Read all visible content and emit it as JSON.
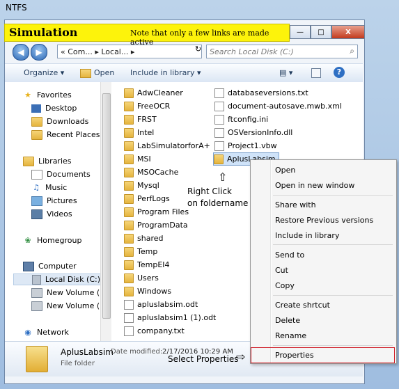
{
  "window": {
    "title": "NTFS"
  },
  "banner": {
    "title": "Simulation",
    "note": "Note that only a few links are made active"
  },
  "window_buttons": {
    "minimize": "—",
    "maximize": "□",
    "close": "X"
  },
  "address": {
    "back": "◀",
    "forward": "▶",
    "path": "«  Com...  ▸  Local...  ▸",
    "refresh": "↻",
    "search_placeholder": "Search Local Disk (C:)"
  },
  "toolbar": {
    "organize": "Organize ▾",
    "open": "Open",
    "include": "Include in library ▾",
    "views": "▤ ▾",
    "help": "?"
  },
  "nav": {
    "favorites": "Favorites",
    "desktop": "Desktop",
    "downloads": "Downloads",
    "recent": "Recent Places",
    "libraries": "Libraries",
    "documents": "Documents",
    "music": "Music",
    "pictures": "Pictures",
    "videos": "Videos",
    "homegroup": "Homegroup",
    "computer": "Computer",
    "localdisk": "Local Disk (C:)",
    "vol_e": "New Volume (E:)",
    "vol_f": "New Volume (F:)",
    "network": "Network"
  },
  "files_left": [
    "AdwCleaner",
    "FreeOCR",
    "FRST",
    "Intel",
    "LabSimulatorforA+",
    "MSI",
    "MSOCache",
    "Mysql",
    "PerfLogs",
    "Program Files",
    "ProgramData",
    "shared",
    "Temp",
    "TempEI4",
    "Users",
    "Windows",
    "apluslabsim.odt",
    "apluslabsim1 (1).odt",
    "company.txt"
  ],
  "files_right": [
    "databaseversions.txt",
    "document-autosave.mwb.xml",
    "ftconfig.ini",
    "OSVersionInfo.dll",
    "Project1.vbw",
    "AplusLabsim"
  ],
  "status": {
    "name": "AplusLabsim",
    "meta": "Date modified:",
    "date": "2/17/2016 10:29 AM",
    "type": "File folder"
  },
  "context_menu": {
    "open": "Open",
    "open_new": "Open in new window",
    "share": "Share with",
    "restore": "Restore Previous versions",
    "include": "Include in library",
    "send": "Send to",
    "cut": "Cut",
    "copy": "Copy",
    "shortcut": "Create shrtcut",
    "delete": "Delete",
    "rename": "Rename",
    "properties": "Properties"
  },
  "annotations": {
    "right_click_1": "Right Click",
    "right_click_2": "on foldername",
    "select_props": "Select Properties"
  }
}
